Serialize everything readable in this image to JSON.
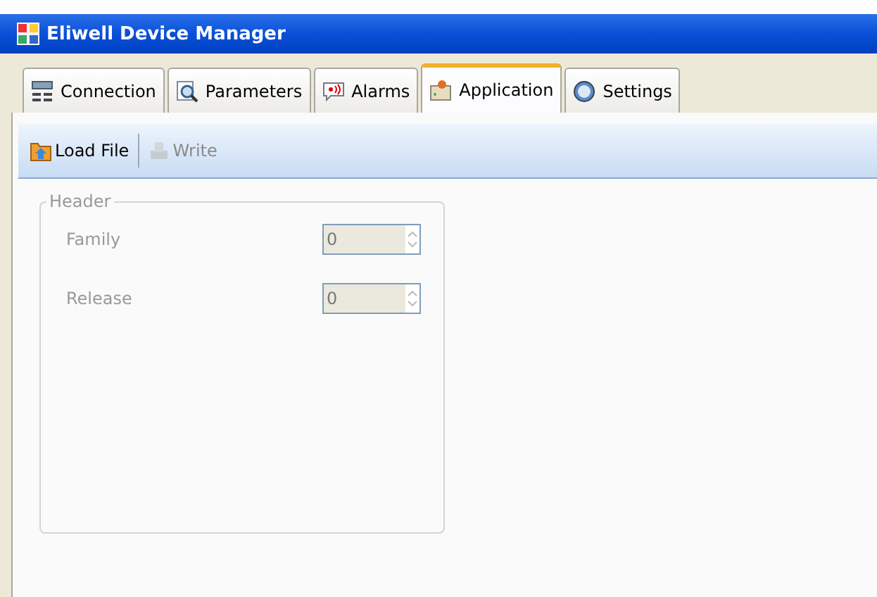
{
  "window": {
    "title": "Eliwell Device Manager"
  },
  "tabs": [
    {
      "label": "Connection",
      "selected": false,
      "kind": "connection"
    },
    {
      "label": "Parameters",
      "selected": false,
      "kind": "parameters"
    },
    {
      "label": "Alarms",
      "selected": false,
      "kind": "alarms"
    },
    {
      "label": "Application",
      "selected": true,
      "kind": "application"
    },
    {
      "label": "Settings",
      "selected": false,
      "kind": "settings"
    }
  ],
  "toolbar": [
    {
      "label": "Load File",
      "disabled": false,
      "kind": "load"
    },
    {
      "label": "Write",
      "disabled": true,
      "kind": "write"
    }
  ],
  "header_group": {
    "title": "Header",
    "disabled": true,
    "fields": [
      {
        "label": "Family",
        "value": "0"
      },
      {
        "label": "Release",
        "value": "0"
      }
    ]
  }
}
